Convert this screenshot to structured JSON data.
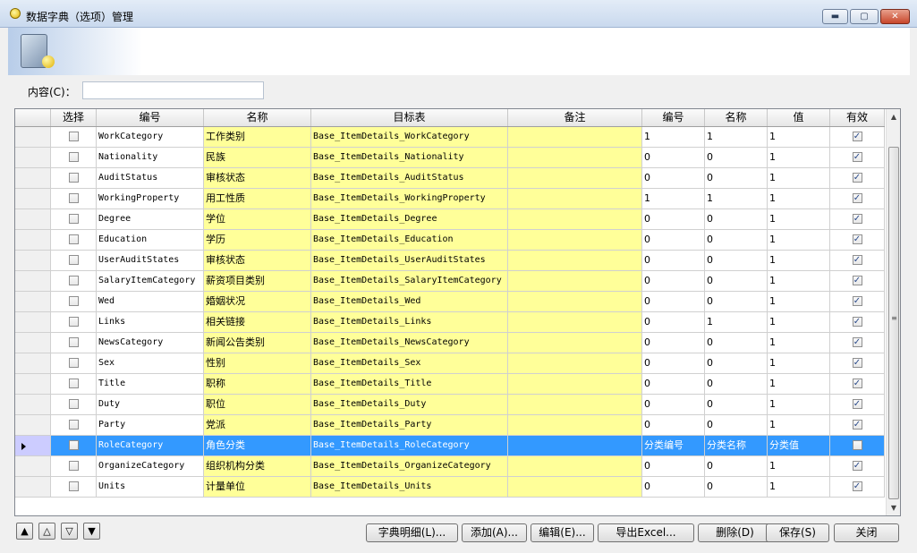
{
  "window": {
    "title": "数据字典（选项）管理",
    "controls": {
      "minimize": "▬",
      "maximize": "▢",
      "close": "✕"
    }
  },
  "filter": {
    "label": "内容(C)：",
    "value": "",
    "placeholder": ""
  },
  "grid": {
    "columns": [
      "",
      "选择",
      "编号",
      "名称",
      "目标表",
      "备注",
      "编号",
      "名称",
      "值",
      "有效"
    ],
    "rows": [
      {
        "selected": false,
        "checked": false,
        "code": "WorkCategory",
        "name": "工作类别",
        "table": "Base_ItemDetails_WorkCategory",
        "note": "",
        "c_code": "1",
        "c_name": "1",
        "c_value": "1",
        "valid": true
      },
      {
        "selected": false,
        "checked": false,
        "code": "Nationality",
        "name": "民族",
        "table": "Base_ItemDetails_Nationality",
        "note": "",
        "c_code": "0",
        "c_name": "0",
        "c_value": "1",
        "valid": true
      },
      {
        "selected": false,
        "checked": false,
        "code": "AuditStatus",
        "name": "审核状态",
        "table": "Base_ItemDetails_AuditStatus",
        "note": "",
        "c_code": "0",
        "c_name": "0",
        "c_value": "1",
        "valid": true
      },
      {
        "selected": false,
        "checked": false,
        "code": "WorkingProperty",
        "name": "用工性质",
        "table": "Base_ItemDetails_WorkingProperty",
        "note": "",
        "c_code": "1",
        "c_name": "1",
        "c_value": "1",
        "valid": true
      },
      {
        "selected": false,
        "checked": false,
        "code": "Degree",
        "name": "学位",
        "table": "Base_ItemDetails_Degree",
        "note": "",
        "c_code": "0",
        "c_name": "0",
        "c_value": "1",
        "valid": true
      },
      {
        "selected": false,
        "checked": false,
        "code": "Education",
        "name": "学历",
        "table": "Base_ItemDetails_Education",
        "note": "",
        "c_code": "0",
        "c_name": "0",
        "c_value": "1",
        "valid": true
      },
      {
        "selected": false,
        "checked": false,
        "code": "UserAuditStates",
        "name": "审核状态",
        "table": "Base_ItemDetails_UserAuditStates",
        "note": "",
        "c_code": "0",
        "c_name": "0",
        "c_value": "1",
        "valid": true
      },
      {
        "selected": false,
        "checked": false,
        "code": "SalaryItemCategory",
        "name": "薪资项目类别",
        "table": "Base_ItemDetails_SalaryItemCategory",
        "note": "",
        "c_code": "0",
        "c_name": "0",
        "c_value": "1",
        "valid": true
      },
      {
        "selected": false,
        "checked": false,
        "code": "Wed",
        "name": "婚姻状况",
        "table": "Base_ItemDetails_Wed",
        "note": "",
        "c_code": "0",
        "c_name": "0",
        "c_value": "1",
        "valid": true
      },
      {
        "selected": false,
        "checked": false,
        "code": "Links",
        "name": "相关链接",
        "table": "Base_ItemDetails_Links",
        "note": "",
        "c_code": "0",
        "c_name": "1",
        "c_value": "1",
        "valid": true
      },
      {
        "selected": false,
        "checked": false,
        "code": "NewsCategory",
        "name": "新闻公告类别",
        "table": "Base_ItemDetails_NewsCategory",
        "note": "",
        "c_code": "0",
        "c_name": "0",
        "c_value": "1",
        "valid": true
      },
      {
        "selected": false,
        "checked": false,
        "code": "Sex",
        "name": "性别",
        "table": "Base_ItemDetails_Sex",
        "note": "",
        "c_code": "0",
        "c_name": "0",
        "c_value": "1",
        "valid": true
      },
      {
        "selected": false,
        "checked": false,
        "code": "Title",
        "name": "职称",
        "table": "Base_ItemDetails_Title",
        "note": "",
        "c_code": "0",
        "c_name": "0",
        "c_value": "1",
        "valid": true
      },
      {
        "selected": false,
        "checked": false,
        "code": "Duty",
        "name": "职位",
        "table": "Base_ItemDetails_Duty",
        "note": "",
        "c_code": "0",
        "c_name": "0",
        "c_value": "1",
        "valid": true
      },
      {
        "selected": false,
        "checked": false,
        "code": "Party",
        "name": "党派",
        "table": "Base_ItemDetails_Party",
        "note": "",
        "c_code": "0",
        "c_name": "0",
        "c_value": "1",
        "valid": true
      },
      {
        "selected": true,
        "checked": false,
        "code": "RoleCategory",
        "name": "角色分类",
        "table": "Base_ItemDetails_RoleCategory",
        "note": "",
        "c_code": "分类编号",
        "c_name": "分类名称",
        "c_value": "分类值",
        "valid": false
      },
      {
        "selected": false,
        "checked": false,
        "code": "OrganizeCategory",
        "name": "组织机构分类",
        "table": "Base_ItemDetails_OrganizeCategory",
        "note": "",
        "c_code": "0",
        "c_name": "0",
        "c_value": "1",
        "valid": true
      },
      {
        "selected": false,
        "checked": false,
        "code": "Units",
        "name": "计量单位",
        "table": "Base_ItemDetails_Units",
        "note": "",
        "c_code": "0",
        "c_name": "0",
        "c_value": "1",
        "valid": true
      }
    ]
  },
  "scrollbar": {
    "up": "▲",
    "down": "▼",
    "grip": "≡"
  },
  "nav": {
    "first": "▲",
    "prev": "△",
    "next": "▽",
    "last": "▼"
  },
  "buttons": {
    "details": "字典明细(L)...",
    "add": "添加(A)...",
    "edit": "编辑(E)...",
    "export": "导出Excel...",
    "delete": "删除(D)",
    "save": "保存(S)",
    "close": "关闭"
  },
  "colors": {
    "highlight": "#ffff99",
    "selection": "#3399ff"
  }
}
